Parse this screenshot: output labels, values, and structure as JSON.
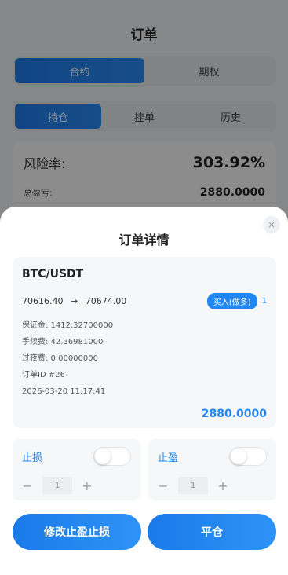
{
  "page": {
    "title": "订单",
    "main_tabs": [
      {
        "label": "合约",
        "active": true
      },
      {
        "label": "期权",
        "active": false
      }
    ],
    "sub_tabs": [
      {
        "label": "持仓",
        "active": true
      },
      {
        "label": "挂单",
        "active": false
      },
      {
        "label": "历史",
        "active": false
      }
    ],
    "risk_label": "风险率:",
    "risk_value": "303.92%",
    "pl_label": "总盈亏:",
    "pl_value": "2880.0000"
  },
  "sheet": {
    "title": "订单详情",
    "close_icon": "×",
    "pair": "BTC/USDT",
    "open_price": "70616.40",
    "arrow": "→",
    "current_price": "70674.00",
    "side": "买入(做多)",
    "leverage": "1",
    "margin": "保证金: 1412.32700000",
    "fee": "手续费: 42.36981000",
    "overnight": "过夜费: 0.00000000",
    "order_id": "订单ID #26",
    "time": "2026-03-20 11:17:41",
    "amount": "2880.0000",
    "stop_loss": {
      "label": "止损",
      "value": "1",
      "minus": "−",
      "plus": "+"
    },
    "take_profit": {
      "label": "止盈",
      "value": "1",
      "minus": "−",
      "plus": "+"
    },
    "modify_button": "修改止盈止损",
    "close_button": "平仓"
  },
  "colors": {
    "accent": "#1f86f2",
    "overlay": "rgba(0,0,0,0.45)"
  }
}
